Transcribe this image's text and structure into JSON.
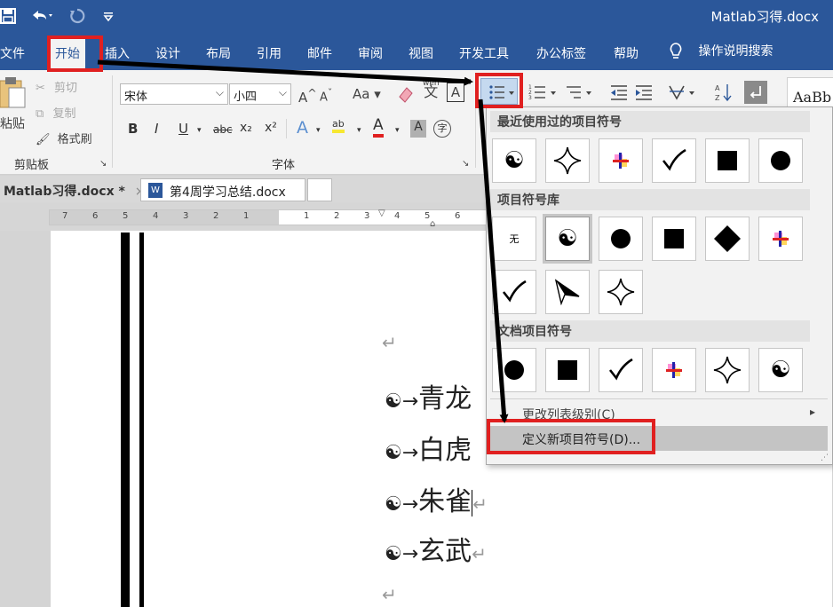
{
  "titlebar": {
    "doc_title": "Matlab习得.docx",
    "save_icon": "save-icon",
    "undo_icon": "undo-icon",
    "redo_icon": "redo-icon",
    "customize_icon": "customize-quick-access-icon"
  },
  "tabs": [
    {
      "label": "文件"
    },
    {
      "label": "开始"
    },
    {
      "label": "插入"
    },
    {
      "label": "设计"
    },
    {
      "label": "布局"
    },
    {
      "label": "引用"
    },
    {
      "label": "邮件"
    },
    {
      "label": "审阅"
    },
    {
      "label": "视图"
    },
    {
      "label": "开发工具"
    },
    {
      "label": "办公标签"
    },
    {
      "label": "帮助"
    }
  ],
  "tell_me": "操作说明搜索",
  "ribbon": {
    "clipboard": {
      "paste": "粘贴",
      "cut": "剪切",
      "copy": "复制",
      "format_painter": "格式刷",
      "label": "剪贴板"
    },
    "font": {
      "font_name": "宋体",
      "font_size": "小四",
      "label": "字体",
      "grow": "A",
      "shrink": "A",
      "case": "Aa",
      "phonetic": "wén",
      "phonetic_char": "文",
      "border_char": "A",
      "bold": "B",
      "italic": "I",
      "underline": "U",
      "strike": "abc",
      "subscript": "x₂",
      "superscript": "x²",
      "text_effect": "A",
      "highlight": "ab",
      "font_color": "A",
      "char_shade": "A",
      "enclose": "字"
    },
    "styles_preview": "AaBb"
  },
  "doc_tabs": {
    "current": "Matlab习得.docx *",
    "other": "第4周学习总结.docx",
    "word_icon": "W"
  },
  "ruler_ticks": [
    "7",
    "6",
    "5",
    "4",
    "3",
    "2",
    "1",
    "",
    "1",
    "2",
    "3",
    "4",
    "5",
    "6"
  ],
  "document": {
    "paragraph_mark": "↵",
    "bullet_symbol": "☯",
    "arrow": "→",
    "items": [
      "青龙",
      "白虎",
      "朱雀",
      "玄武"
    ]
  },
  "dropdown": {
    "recent_header": "最近使用过的项目符号",
    "library_header": "项目符号库",
    "document_header": "文档项目符号",
    "none_label": "无",
    "recent": [
      "yin-yang",
      "four-point-star",
      "color-plus",
      "checkmark",
      "square",
      "circle"
    ],
    "library": [
      "none",
      "yin-yang",
      "circle",
      "square",
      "diamond",
      "color-plus",
      "checkmark",
      "arrowhead",
      "four-point-star"
    ],
    "document": [
      "circle",
      "square",
      "checkmark",
      "color-plus",
      "four-point-star",
      "yin-yang"
    ],
    "change_level": "更改列表级别(C)",
    "define_new": "定义新项目符号(D)..."
  },
  "colors": {
    "title_bar": "#2b579a",
    "highlight_red": "#e02020",
    "arrow_black": "#000000"
  }
}
